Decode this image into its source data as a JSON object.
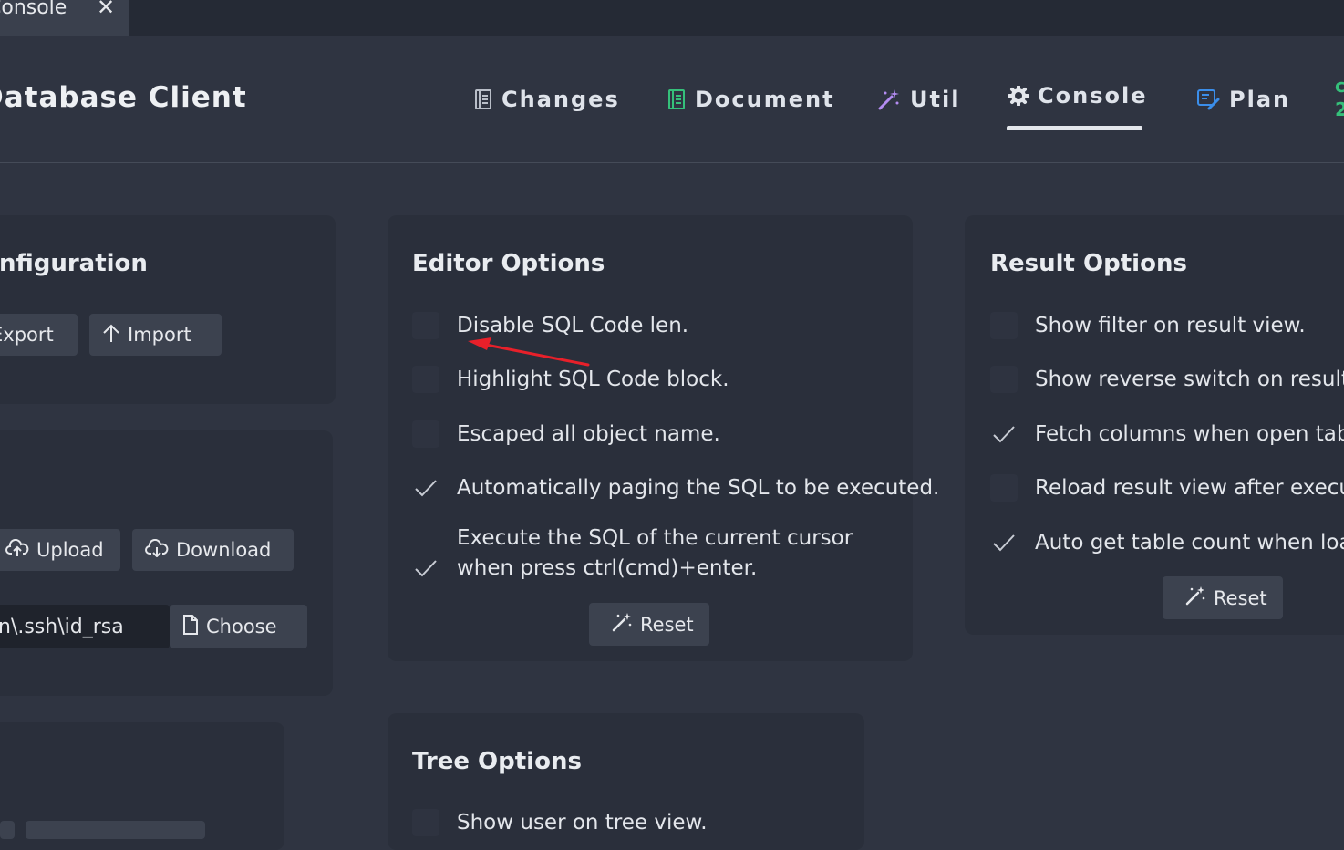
{
  "tab": {
    "label": "Console",
    "close": "✕"
  },
  "header": {
    "title": "Database Client",
    "nav": [
      {
        "label": "Changes",
        "icon": "book-icon",
        "active": false
      },
      {
        "label": "Document",
        "icon": "document-icon",
        "active": false
      },
      {
        "label": "Util",
        "icon": "magic-wand-icon",
        "active": false
      },
      {
        "label": "Console",
        "icon": "gear-icon",
        "active": true
      },
      {
        "label": "Plan",
        "icon": "plan-icon",
        "active": false
      }
    ],
    "extra_top": "c",
    "extra_bottom": "2"
  },
  "configuration": {
    "title": "Configuration",
    "export_label": "Export",
    "import_label": "Import"
  },
  "ssh": {
    "upload_label": "Upload",
    "download_label": "Download",
    "key_path": "n\\.ssh\\id_rsa",
    "choose_label": "Choose"
  },
  "editor_options": {
    "title": "Editor Options",
    "items": [
      {
        "label": "Disable SQL Code len.",
        "checked": false
      },
      {
        "label": "Highlight SQL Code block.",
        "checked": false
      },
      {
        "label": "Escaped all object name.",
        "checked": false
      },
      {
        "label": "Automatically paging the SQL to be executed.",
        "checked": true
      },
      {
        "label": "Execute the SQL of the current cursor when press ctrl(cmd)+enter.",
        "checked": true
      }
    ],
    "reset_label": "Reset"
  },
  "result_options": {
    "title": "Result Options",
    "items": [
      {
        "label": "Show filter on result view.",
        "checked": false
      },
      {
        "label": "Show reverse switch on result vi",
        "checked": false
      },
      {
        "label": "Fetch columns when open table",
        "checked": true
      },
      {
        "label": "Reload result view after execute",
        "checked": false
      },
      {
        "label": "Auto get table count when load",
        "checked": true
      }
    ],
    "reset_label": "Reset"
  },
  "tree_options": {
    "title": "Tree Options",
    "items": [
      {
        "label": "Show user on tree view.",
        "checked": false
      }
    ]
  },
  "colors": {
    "background": "#2f3441",
    "card": "#2a2f3b",
    "button": "#3c424f",
    "accent_green": "#35c07a",
    "annotation_red": "#e8202a",
    "plan_icon_blue": "#3b8eea",
    "util_icon_purple": "#b48cf2"
  }
}
